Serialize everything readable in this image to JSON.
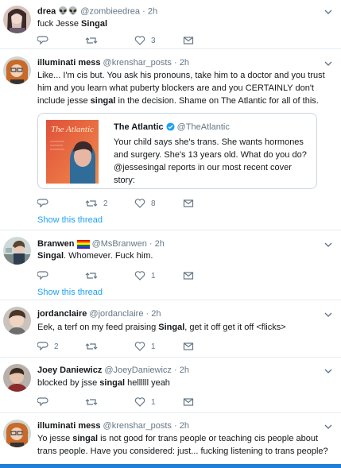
{
  "tweets": [
    {
      "name": "drea",
      "emoji": "👽👽",
      "handle": "@zombieedrea",
      "dot": "·",
      "time": "2h",
      "text_pre": "fuck Jesse ",
      "text_bold": "Singal",
      "text_post": "",
      "replies": "",
      "retweets": "",
      "likes": "3"
    },
    {
      "name": "illuminati mess",
      "handle": "@krenshar_posts",
      "dot": "·",
      "time": "2h",
      "text_pre": "Like... I'm cis but. You ask his pronouns, take him to a doctor and you trust him and you learn what puberty blockers are and you CERTAINLY don't include jesse ",
      "text_bold": "singal",
      "text_post": " in the decision. Shame on The Atlantic for all of this.",
      "replies": "",
      "retweets": "2",
      "likes": "8",
      "show_thread": "Show this thread",
      "quote": {
        "name": "The Atlantic",
        "handle": "@TheAtlantic",
        "text": "Your child says she's trans. She wants hormones and surgery. She's 13 years old. What do you do? @jessesingal reports in our most recent cover story:",
        "cover_title": "The Atlantic",
        "verified_icon": "verified-badge-icon"
      }
    },
    {
      "name": "Branwen",
      "emoji": "🏳️‍🌈",
      "handle": "@MsBranwen",
      "dot": "·",
      "time": "2h",
      "text_pre": "",
      "text_bold": "Singal",
      "text_post": ". Whomever. Fuck him.",
      "replies": "",
      "retweets": "",
      "likes": "1",
      "show_thread": "Show this thread"
    },
    {
      "name": "jordanclaire",
      "handle": "@jordanclaire",
      "dot": "·",
      "time": "2h",
      "text_pre": "Eek, a terf on my feed praising ",
      "text_bold": "Singal",
      "text_post": ", get it off get it off <flicks>",
      "replies": "2",
      "retweets": "",
      "likes": "1"
    },
    {
      "name": "Joey Daniewicz",
      "handle": "@JoeyDaniewicz",
      "dot": "·",
      "time": "2h",
      "text_pre": "blocked by jsse ",
      "text_bold": "singal",
      "text_post": " hellllll yeah",
      "replies": "",
      "retweets": "",
      "likes": "1"
    },
    {
      "name": "illuminati mess",
      "handle": "@krenshar_posts",
      "dot": "·",
      "time": "2h",
      "text_pre": "Yo jesse ",
      "text_bold": "singal",
      "text_post": " is not good for trans people or teaching cis people about trans people. Have you considered: just... fucking listening to trans people?"
    }
  ],
  "colors": {
    "link": "#1da1f2",
    "muted": "#657786",
    "divider": "#e6ecf0",
    "bottom_bar": "#1d7fd8"
  },
  "icons": {
    "reply": "reply-icon",
    "retweet": "retweet-icon",
    "like": "like-icon",
    "message": "direct-message-icon",
    "more": "chevron-down-icon"
  }
}
